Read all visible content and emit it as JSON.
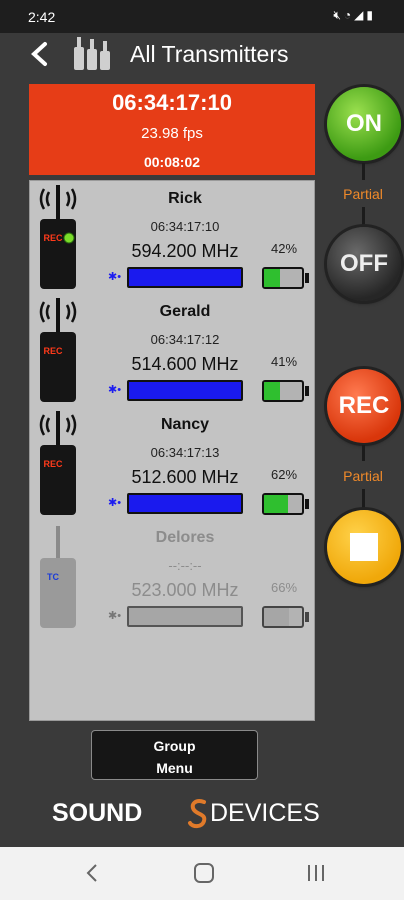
{
  "status_bar": {
    "time": "2:42",
    "icons": [
      "mute-icon",
      "wifi-icon",
      "signal-icon",
      "battery-icon"
    ]
  },
  "app_bar": {
    "title": "All Transmitters",
    "back_icon": "back-chevron-icon",
    "logo_icon": "bottles-icon"
  },
  "timecode": {
    "main": "06:34:17:10",
    "fps": "23.98 fps",
    "elapsed": "00:08:02",
    "background": "#e63d17"
  },
  "transmitters": [
    {
      "name": "Rick",
      "timecode": "06:34:17:10",
      "frequency": "594.200 MHz",
      "battery_label": "42%",
      "battery_level": 0.42,
      "rf_level": 1.0,
      "rec": true,
      "badge": "REC",
      "active": true
    },
    {
      "name": "Gerald",
      "timecode": "06:34:17:12",
      "frequency": "514.600 MHz",
      "battery_label": "41%",
      "battery_level": 0.41,
      "rf_level": 1.0,
      "rec": true,
      "badge": "REC",
      "active": true
    },
    {
      "name": "Nancy",
      "timecode": "06:34:17:13",
      "frequency": "512.600 MHz",
      "battery_label": "62%",
      "battery_level": 0.62,
      "rf_level": 1.0,
      "rec": true,
      "badge": "REC",
      "active": true
    },
    {
      "name": "Delores",
      "timecode": "--:--:--",
      "frequency": "523.000 MHz",
      "battery_label": "66%",
      "battery_level": 0.66,
      "rf_level": 0.0,
      "rec": false,
      "badge": "TC",
      "active": false
    }
  ],
  "controls": {
    "on_label": "ON",
    "off_label": "OFF",
    "rec_label": "REC",
    "partial_top": "Partial",
    "partial_bottom": "Partial",
    "stop_icon": "stop-icon",
    "on_color": "#3d9b13",
    "rec_color": "#d9360b",
    "stop_color": "#f0a80a",
    "partial_color": "#f08a2a"
  },
  "group_menu": {
    "line1": "Group",
    "line2": "Menu"
  },
  "brand": {
    "part1": "SOUND",
    "part2": "DEVICES"
  },
  "nav_bar": {
    "icons": [
      "back-icon",
      "home-icon",
      "recents-icon"
    ]
  }
}
